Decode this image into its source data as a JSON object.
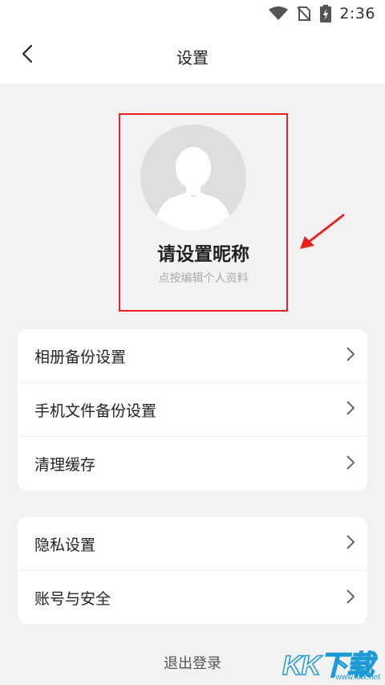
{
  "status_bar": {
    "time": "2:36"
  },
  "header": {
    "title": "设置"
  },
  "profile": {
    "nickname": "请设置昵称",
    "hint": "点按编辑个人资料"
  },
  "group1": {
    "items": [
      {
        "label": "相册备份设置"
      },
      {
        "label": "手机文件备份设置"
      },
      {
        "label": "清理缓存"
      }
    ]
  },
  "group2": {
    "items": [
      {
        "label": "隐私设置"
      },
      {
        "label": "账号与安全"
      }
    ]
  },
  "logout_label": "退出登录",
  "watermark": {
    "brand": "KK下载",
    "url": "www.kkx.net"
  },
  "colors": {
    "highlight": "#e8221e",
    "background": "#f2f2f2",
    "watermark": "#1d9ad6"
  }
}
